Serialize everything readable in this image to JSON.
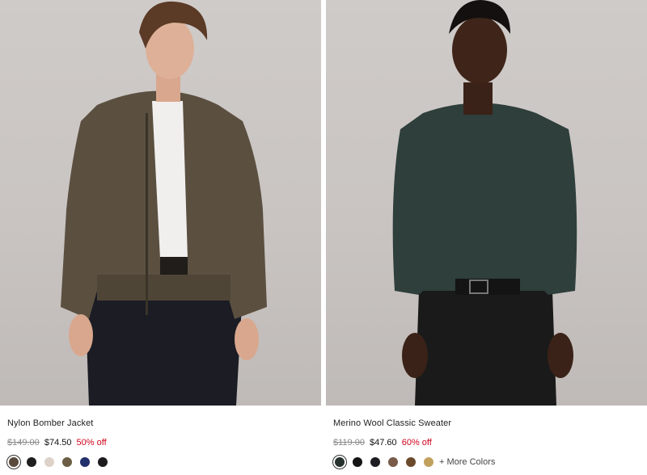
{
  "products": [
    {
      "name": "Nylon Bomber Jacket",
      "original_price": "$149.00",
      "sale_price": "$74.50",
      "discount": "50% off",
      "swatches": [
        "#5a4a3c",
        "#1f1e1e",
        "#ddd2c8",
        "#6b5e45",
        "#22306b",
        "#1d1b1d"
      ],
      "selected_swatch": 0,
      "more_colors": ""
    },
    {
      "name": "Merino Wool Classic Sweater",
      "original_price": "$119.00",
      "sale_price": "$47.60",
      "discount": "60% off",
      "swatches": [
        "#26322e",
        "#141414",
        "#1c1c22",
        "#7a5a49",
        "#6b4a2c",
        "#c1a15c"
      ],
      "selected_swatch": 0,
      "more_colors": "+ More Colors"
    }
  ],
  "colors": {
    "discount": "#d0021b",
    "strikethrough": "#8a8a8a"
  }
}
